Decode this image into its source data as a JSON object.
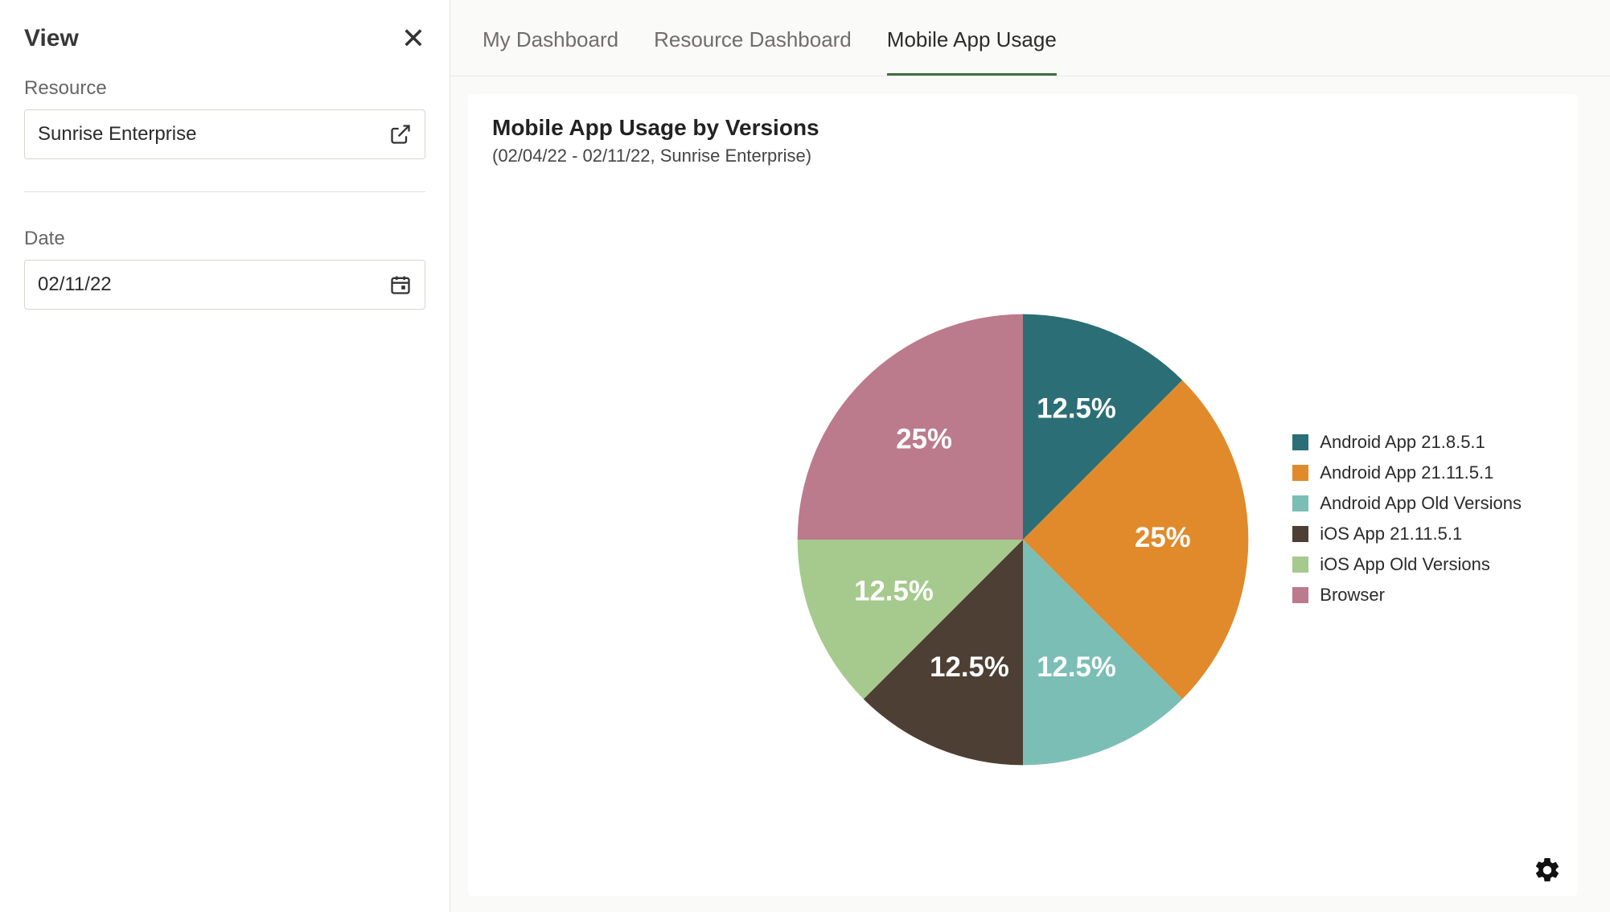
{
  "sidebar": {
    "title": "View",
    "resource_label": "Resource",
    "resource_value": "Sunrise Enterprise",
    "date_label": "Date",
    "date_value": "02/11/22"
  },
  "tabs": [
    {
      "label": "My Dashboard",
      "active": false
    },
    {
      "label": "Resource Dashboard",
      "active": false
    },
    {
      "label": "Mobile App Usage",
      "active": true
    }
  ],
  "card": {
    "title": "Mobile App Usage by Versions",
    "subtitle": "(02/04/22 - 02/11/22, Sunrise Enterprise)"
  },
  "chart_data": {
    "type": "pie",
    "title": "Mobile App Usage by Versions",
    "series": [
      {
        "name": "Android App 21.8.5.1",
        "value": 12.5,
        "label": "12.5%",
        "color": "#2b6e75"
      },
      {
        "name": "Android App 21.11.5.1",
        "value": 25,
        "label": "25%",
        "color": "#e08a2b"
      },
      {
        "name": "Android App Old Versions",
        "value": 12.5,
        "label": "12.5%",
        "color": "#7bbeb6"
      },
      {
        "name": "iOS App 21.11.5.1",
        "value": 12.5,
        "label": "12.5%",
        "color": "#4d3f33"
      },
      {
        "name": "iOS App Old Versions",
        "value": 12.5,
        "label": "12.5%",
        "color": "#a6c98e"
      },
      {
        "name": "Browser",
        "value": 25,
        "label": "25%",
        "color": "#bb7b8c"
      }
    ]
  }
}
